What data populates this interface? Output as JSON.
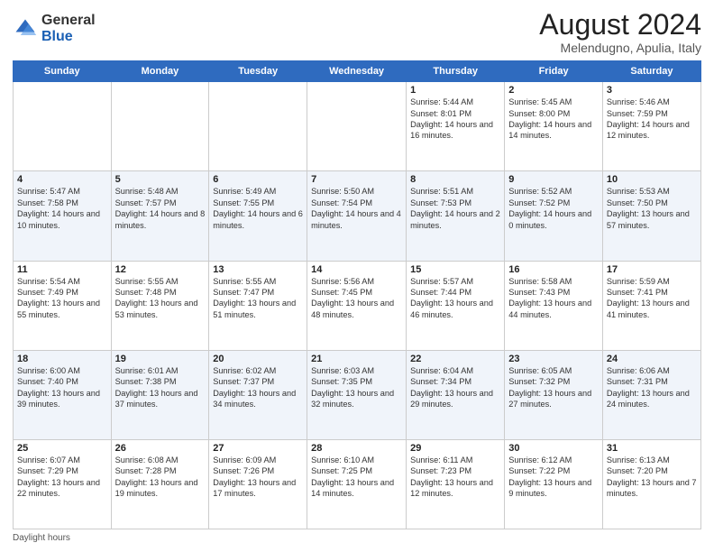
{
  "header": {
    "logo_general": "General",
    "logo_blue": "Blue",
    "main_title": "August 2024",
    "subtitle": "Melendugno, Apulia, Italy"
  },
  "days_of_week": [
    "Sunday",
    "Monday",
    "Tuesday",
    "Wednesday",
    "Thursday",
    "Friday",
    "Saturday"
  ],
  "footer": {
    "daylight_label": "Daylight hours"
  },
  "weeks": [
    [
      {
        "day": "",
        "info": ""
      },
      {
        "day": "",
        "info": ""
      },
      {
        "day": "",
        "info": ""
      },
      {
        "day": "",
        "info": ""
      },
      {
        "day": "1",
        "info": "Sunrise: 5:44 AM\nSunset: 8:01 PM\nDaylight: 14 hours and 16 minutes."
      },
      {
        "day": "2",
        "info": "Sunrise: 5:45 AM\nSunset: 8:00 PM\nDaylight: 14 hours and 14 minutes."
      },
      {
        "day": "3",
        "info": "Sunrise: 5:46 AM\nSunset: 7:59 PM\nDaylight: 14 hours and 12 minutes."
      }
    ],
    [
      {
        "day": "4",
        "info": "Sunrise: 5:47 AM\nSunset: 7:58 PM\nDaylight: 14 hours and 10 minutes."
      },
      {
        "day": "5",
        "info": "Sunrise: 5:48 AM\nSunset: 7:57 PM\nDaylight: 14 hours and 8 minutes."
      },
      {
        "day": "6",
        "info": "Sunrise: 5:49 AM\nSunset: 7:55 PM\nDaylight: 14 hours and 6 minutes."
      },
      {
        "day": "7",
        "info": "Sunrise: 5:50 AM\nSunset: 7:54 PM\nDaylight: 14 hours and 4 minutes."
      },
      {
        "day": "8",
        "info": "Sunrise: 5:51 AM\nSunset: 7:53 PM\nDaylight: 14 hours and 2 minutes."
      },
      {
        "day": "9",
        "info": "Sunrise: 5:52 AM\nSunset: 7:52 PM\nDaylight: 14 hours and 0 minutes."
      },
      {
        "day": "10",
        "info": "Sunrise: 5:53 AM\nSunset: 7:50 PM\nDaylight: 13 hours and 57 minutes."
      }
    ],
    [
      {
        "day": "11",
        "info": "Sunrise: 5:54 AM\nSunset: 7:49 PM\nDaylight: 13 hours and 55 minutes."
      },
      {
        "day": "12",
        "info": "Sunrise: 5:55 AM\nSunset: 7:48 PM\nDaylight: 13 hours and 53 minutes."
      },
      {
        "day": "13",
        "info": "Sunrise: 5:55 AM\nSunset: 7:47 PM\nDaylight: 13 hours and 51 minutes."
      },
      {
        "day": "14",
        "info": "Sunrise: 5:56 AM\nSunset: 7:45 PM\nDaylight: 13 hours and 48 minutes."
      },
      {
        "day": "15",
        "info": "Sunrise: 5:57 AM\nSunset: 7:44 PM\nDaylight: 13 hours and 46 minutes."
      },
      {
        "day": "16",
        "info": "Sunrise: 5:58 AM\nSunset: 7:43 PM\nDaylight: 13 hours and 44 minutes."
      },
      {
        "day": "17",
        "info": "Sunrise: 5:59 AM\nSunset: 7:41 PM\nDaylight: 13 hours and 41 minutes."
      }
    ],
    [
      {
        "day": "18",
        "info": "Sunrise: 6:00 AM\nSunset: 7:40 PM\nDaylight: 13 hours and 39 minutes."
      },
      {
        "day": "19",
        "info": "Sunrise: 6:01 AM\nSunset: 7:38 PM\nDaylight: 13 hours and 37 minutes."
      },
      {
        "day": "20",
        "info": "Sunrise: 6:02 AM\nSunset: 7:37 PM\nDaylight: 13 hours and 34 minutes."
      },
      {
        "day": "21",
        "info": "Sunrise: 6:03 AM\nSunset: 7:35 PM\nDaylight: 13 hours and 32 minutes."
      },
      {
        "day": "22",
        "info": "Sunrise: 6:04 AM\nSunset: 7:34 PM\nDaylight: 13 hours and 29 minutes."
      },
      {
        "day": "23",
        "info": "Sunrise: 6:05 AM\nSunset: 7:32 PM\nDaylight: 13 hours and 27 minutes."
      },
      {
        "day": "24",
        "info": "Sunrise: 6:06 AM\nSunset: 7:31 PM\nDaylight: 13 hours and 24 minutes."
      }
    ],
    [
      {
        "day": "25",
        "info": "Sunrise: 6:07 AM\nSunset: 7:29 PM\nDaylight: 13 hours and 22 minutes."
      },
      {
        "day": "26",
        "info": "Sunrise: 6:08 AM\nSunset: 7:28 PM\nDaylight: 13 hours and 19 minutes."
      },
      {
        "day": "27",
        "info": "Sunrise: 6:09 AM\nSunset: 7:26 PM\nDaylight: 13 hours and 17 minutes."
      },
      {
        "day": "28",
        "info": "Sunrise: 6:10 AM\nSunset: 7:25 PM\nDaylight: 13 hours and 14 minutes."
      },
      {
        "day": "29",
        "info": "Sunrise: 6:11 AM\nSunset: 7:23 PM\nDaylight: 13 hours and 12 minutes."
      },
      {
        "day": "30",
        "info": "Sunrise: 6:12 AM\nSunset: 7:22 PM\nDaylight: 13 hours and 9 minutes."
      },
      {
        "day": "31",
        "info": "Sunrise: 6:13 AM\nSunset: 7:20 PM\nDaylight: 13 hours and 7 minutes."
      }
    ]
  ]
}
